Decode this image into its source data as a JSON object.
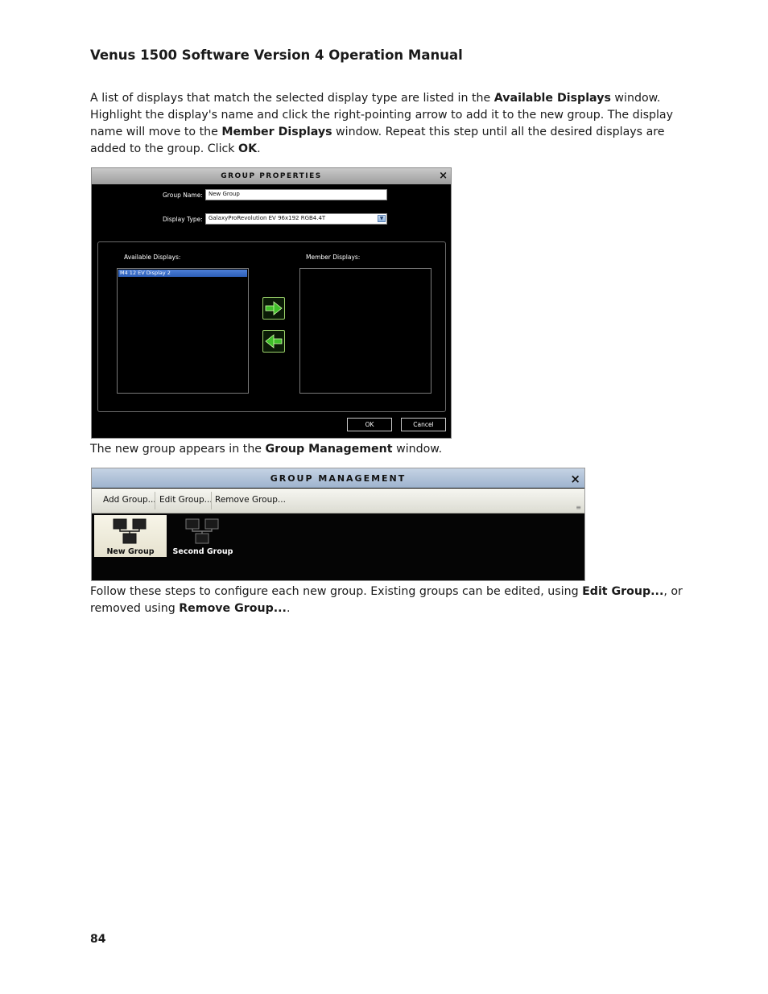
{
  "header": {
    "title": "Venus 1500 Software Version 4 Operation Manual"
  },
  "para1": {
    "t1": "A list of displays that match the selected display type are listed in the ",
    "b1": "Available Displays",
    "t2": " window. Highlight the display's name and click the right-pointing arrow to add it to the new group. The display name will move to the ",
    "b2": "Member Displays",
    "t3": " window. Repeat this step until all the desired displays are added to the group. Click ",
    "b3": "OK",
    "t4": "."
  },
  "group_properties": {
    "title": "Group Properties",
    "close": "×",
    "group_name_label": "Group Name:",
    "group_name_value": "New Group",
    "display_type_label": "Display Type:",
    "display_type_value": "GalaxyProRevolution EV 96x192 RGB4.4T",
    "available_label": "Available Displays:",
    "available_items": [
      "M4 12 EV Display 2"
    ],
    "member_label": "Member Displays:",
    "ok_label": "OK",
    "cancel_label": "Cancel",
    "arrow_color": "#3fbf2a"
  },
  "para2": {
    "t1": "The new group appears in the ",
    "b1": "Group Management",
    "t2": " window."
  },
  "group_management": {
    "title": "Group Management",
    "close": "×",
    "toolbar": {
      "add": "Add Group...",
      "edit": "Edit Group...",
      "remove": "Remove Group..."
    },
    "groups": [
      {
        "name": "New Group",
        "selected": true
      },
      {
        "name": "Second Group",
        "selected": false
      }
    ]
  },
  "para3": {
    "t1": "Follow these steps to configure each new group. Existing groups can be edited, using ",
    "b1": "Edit Group...",
    "t2": ", or removed using ",
    "b2": "Remove Group...",
    "t3": "."
  },
  "footer": {
    "page_number": "84"
  }
}
